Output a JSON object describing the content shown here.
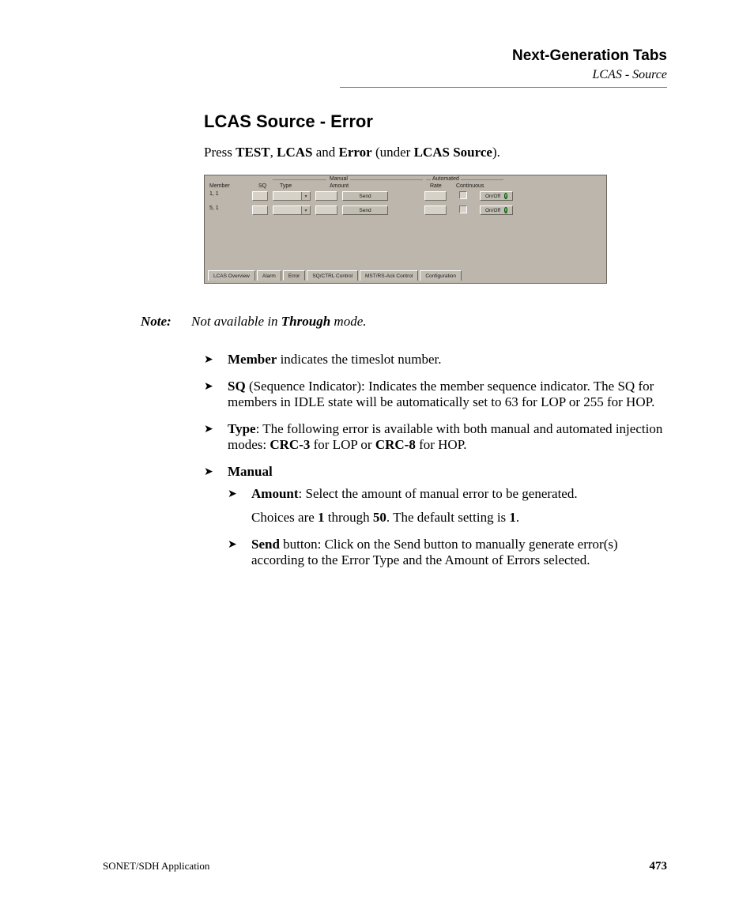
{
  "header": {
    "chapter": "Next-Generation Tabs",
    "section": "LCAS - Source"
  },
  "heading": "LCAS Source - Error",
  "lead": {
    "pre": "Press ",
    "b1": "TEST",
    "sep1": ", ",
    "b2": "LCAS",
    "mid": " and ",
    "b3": "Error",
    "post1": " (under ",
    "b4": "LCAS Source",
    "post2": ")."
  },
  "screenshot": {
    "group_manual": "Manual",
    "group_auto": "Automated",
    "cols": {
      "member": "Member",
      "sq": "SQ",
      "type": "Type",
      "amount": "Amount",
      "rate": "Rate",
      "continuous": "Continuous"
    },
    "rows": [
      {
        "member": "1, 1",
        "send": "Send",
        "onoff": "On/Off"
      },
      {
        "member": "5, 1",
        "send": "Send",
        "onoff": "On/Off"
      }
    ],
    "tabs": [
      "LCAS Overview",
      "Alarm",
      "Error",
      "SQ/CTRL Control",
      "MST/RS-Ack Control",
      "Configuration"
    ],
    "active_tab": 2,
    "dd_glyph": "▾"
  },
  "note": {
    "label": "Note:",
    "pre": "Not available in ",
    "b": "Through",
    "post": " mode."
  },
  "bullets": {
    "member": {
      "b": "Member",
      "rest": " indicates the timeslot number."
    },
    "sq": {
      "b": "SQ",
      "rest": " (Sequence Indicator): Indicates the member sequence indicator. The SQ for members in IDLE state will be automatically set to 63 for LOP or 255 for HOP."
    },
    "type": {
      "b": "Type",
      "mid": ": The following error is available with both manual and automated injection modes: ",
      "b2": "CRC-3",
      "mid2": " for LOP or ",
      "b3": "CRC-8",
      "post": " for HOP."
    },
    "manual_b": "Manual",
    "amount": {
      "b": "Amount",
      "rest": ": Select the amount of manual error to be generated.",
      "p2_pre": "Choices are ",
      "p2_b1": "1",
      "p2_mid": " through ",
      "p2_b2": "50",
      "p2_mid2": ". The default setting is ",
      "p2_b3": "1",
      "p2_post": "."
    },
    "send": {
      "b": "Send",
      "rest": " button: Click on the Send button to manually generate error(s) according to the Error Type and the Amount of Errors selected."
    }
  },
  "footer": {
    "app": "SONET/SDH Application",
    "page": "473"
  }
}
